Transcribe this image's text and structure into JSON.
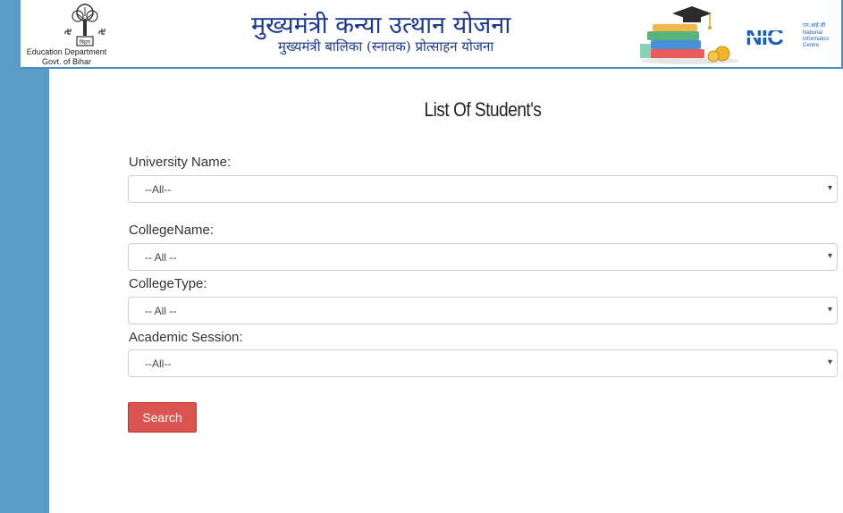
{
  "header": {
    "department_line1": "Education Department",
    "department_line2": "Govt. of Bihar",
    "title_hindi": "मुख्यमंत्री कन्या उत्थान योजना",
    "subtitle_hindi": "मुख्यमंत्री बालिका (स्नातक) प्रोत्साहन योजना",
    "nic_logo_text": "NIC",
    "nic_hindi": "एन.आई.सी",
    "nic_line1": "National",
    "nic_line2": "Informatics",
    "nic_line3": "Centre"
  },
  "page_title": "List Of Student's",
  "form": {
    "university": {
      "label": "University Name:",
      "value": "--All--"
    },
    "college_name": {
      "label": "CollegeName:",
      "value": "-- All --"
    },
    "college_type": {
      "label": "CollegeType:",
      "value": "-- All --"
    },
    "academic_session": {
      "label": "Academic Session:",
      "value": "--All--"
    },
    "search_label": "Search",
    "dropdown_glyph": "▾"
  },
  "colors": {
    "sidebar": "#5a9bc8",
    "header_border": "#4a8fc2",
    "title_blue": "#1d3a8a",
    "search_button": "#d9534f"
  },
  "icons": [
    "bihar-emblem-icon",
    "books-graduation-cap-icon",
    "nic-logo-icon",
    "chevron-down-icon"
  ]
}
